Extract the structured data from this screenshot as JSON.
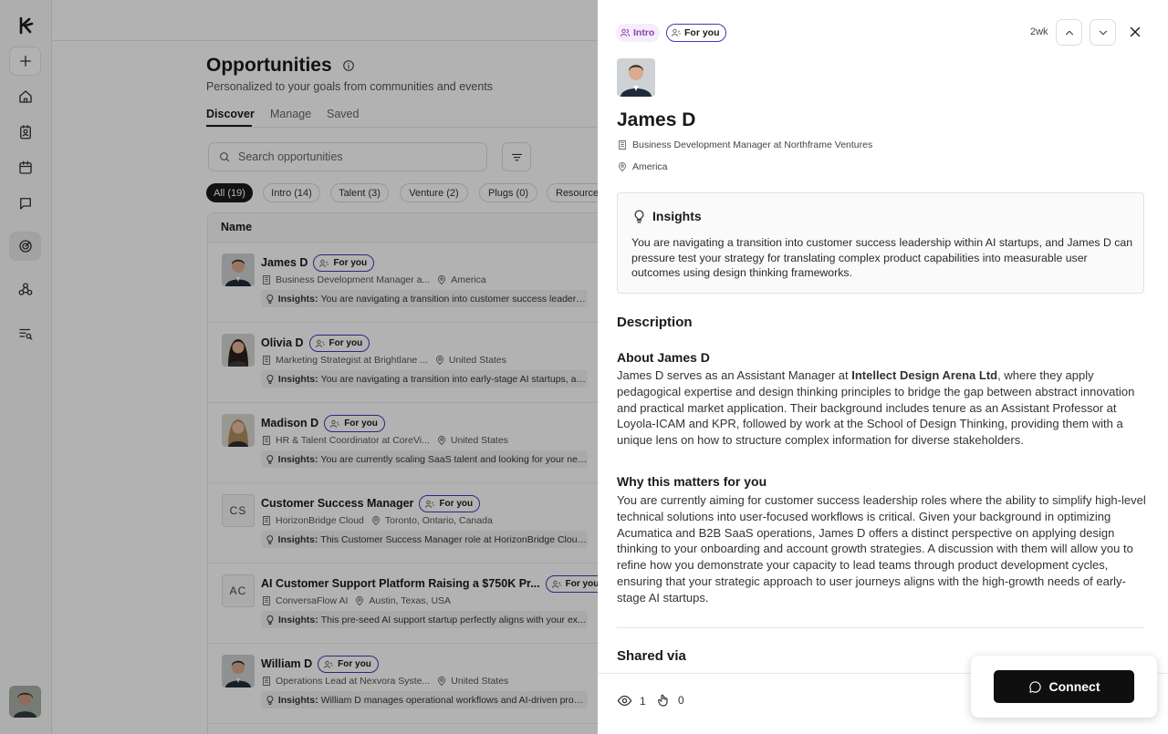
{
  "main": {
    "title": "Opportunities",
    "subtitle": "Personalized to your goals from communities and events",
    "tabs": [
      "Discover",
      "Manage",
      "Saved"
    ],
    "search_placeholder": "Search opportunities",
    "chips": [
      "All (19)",
      "Intro (14)",
      "Talent (3)",
      "Venture (2)",
      "Plugs (0)",
      "Resource"
    ],
    "table_header": "Name",
    "for_you_label": "For you",
    "insights_label": "Insights:",
    "rows": [
      {
        "name": "James D",
        "org": "Business Development Manager a...",
        "location": "America",
        "insight": "You are navigating a transition into customer success leadersh..."
      },
      {
        "name": "Olivia D",
        "org": "Marketing Strategist at Brightlane ...",
        "location": "United States",
        "insight": "You are navigating a transition into early-stage AI startups, an..."
      },
      {
        "name": "Madison D",
        "org": "HR & Talent Coordinator at CoreVi...",
        "location": "United States",
        "insight": "You are currently scaling SaaS talent and looking for your next ..."
      },
      {
        "name": "Customer Success Manager",
        "initials": "CS",
        "org": "HorizonBridge Cloud",
        "location": "Toronto, Ontario, Canada",
        "insight": "This Customer Success Manager role at HorizonBridge Cloud p..."
      },
      {
        "name": "AI Customer Support Platform Raising a $750K Pr...",
        "initials": "AC",
        "org": "ConversaFlow AI",
        "location": "Austin, Texas, USA",
        "insight": "This pre-seed AI support startup perfectly aligns with your ex..."
      },
      {
        "name": "William D",
        "org": "Operations Lead at Nexvora Syste...",
        "location": "United States",
        "insight": "William D manages operational workflows and AI-driven proce..."
      }
    ]
  },
  "panel": {
    "badge_intro": "Intro",
    "badge_foryou": "For you",
    "age": "2wk",
    "name": "James D",
    "role": "Business Development Manager at Northframe Ventures",
    "location": "America",
    "insights_title": "Insights",
    "insights_text": "You are navigating a transition into customer success leadership within AI startups, and James D can pressure test your strategy for translating complex product capabilities into measurable user outcomes using design thinking frameworks.",
    "description_title": "Description",
    "about_title": "About James D",
    "about_pre": "James D serves as an Assistant Manager at ",
    "about_bold": "Intellect Design Arena Ltd",
    "about_post": ", where they apply pedagogical expertise and design thinking principles to bridge the gap between abstract innovation and practical market application. Their background includes tenure as an Assistant Professor at Loyola-ICAM and KPR, followed by work at the School of Design Thinking, providing them with a unique lens on how to structure complex information for diverse stakeholders.",
    "why_title": "Why this matters for you",
    "why_text": "You are currently aiming for customer success leadership roles where the ability to simplify high-level technical solutions into user-focused workflows is critical. Given your background in optimizing Acumatica and B2B SaaS operations, James D offers a distinct perspective on applying design thinking to your onboarding and account growth strategies. A discussion with them will allow you to refine how you demonstrate your capacity to lead teams through product development cycles, ensuring that your strategic approach to user journeys aligns with the high-growth needs of early-stage AI startups.",
    "shared_title": "Shared via",
    "views": "1",
    "plugs": "0",
    "connect_label": "Connect"
  },
  "colors": {
    "accent_blue": "#3b3bb8",
    "intro_purple": "#8b3fb3",
    "connect_black": "#0f0f0f"
  }
}
